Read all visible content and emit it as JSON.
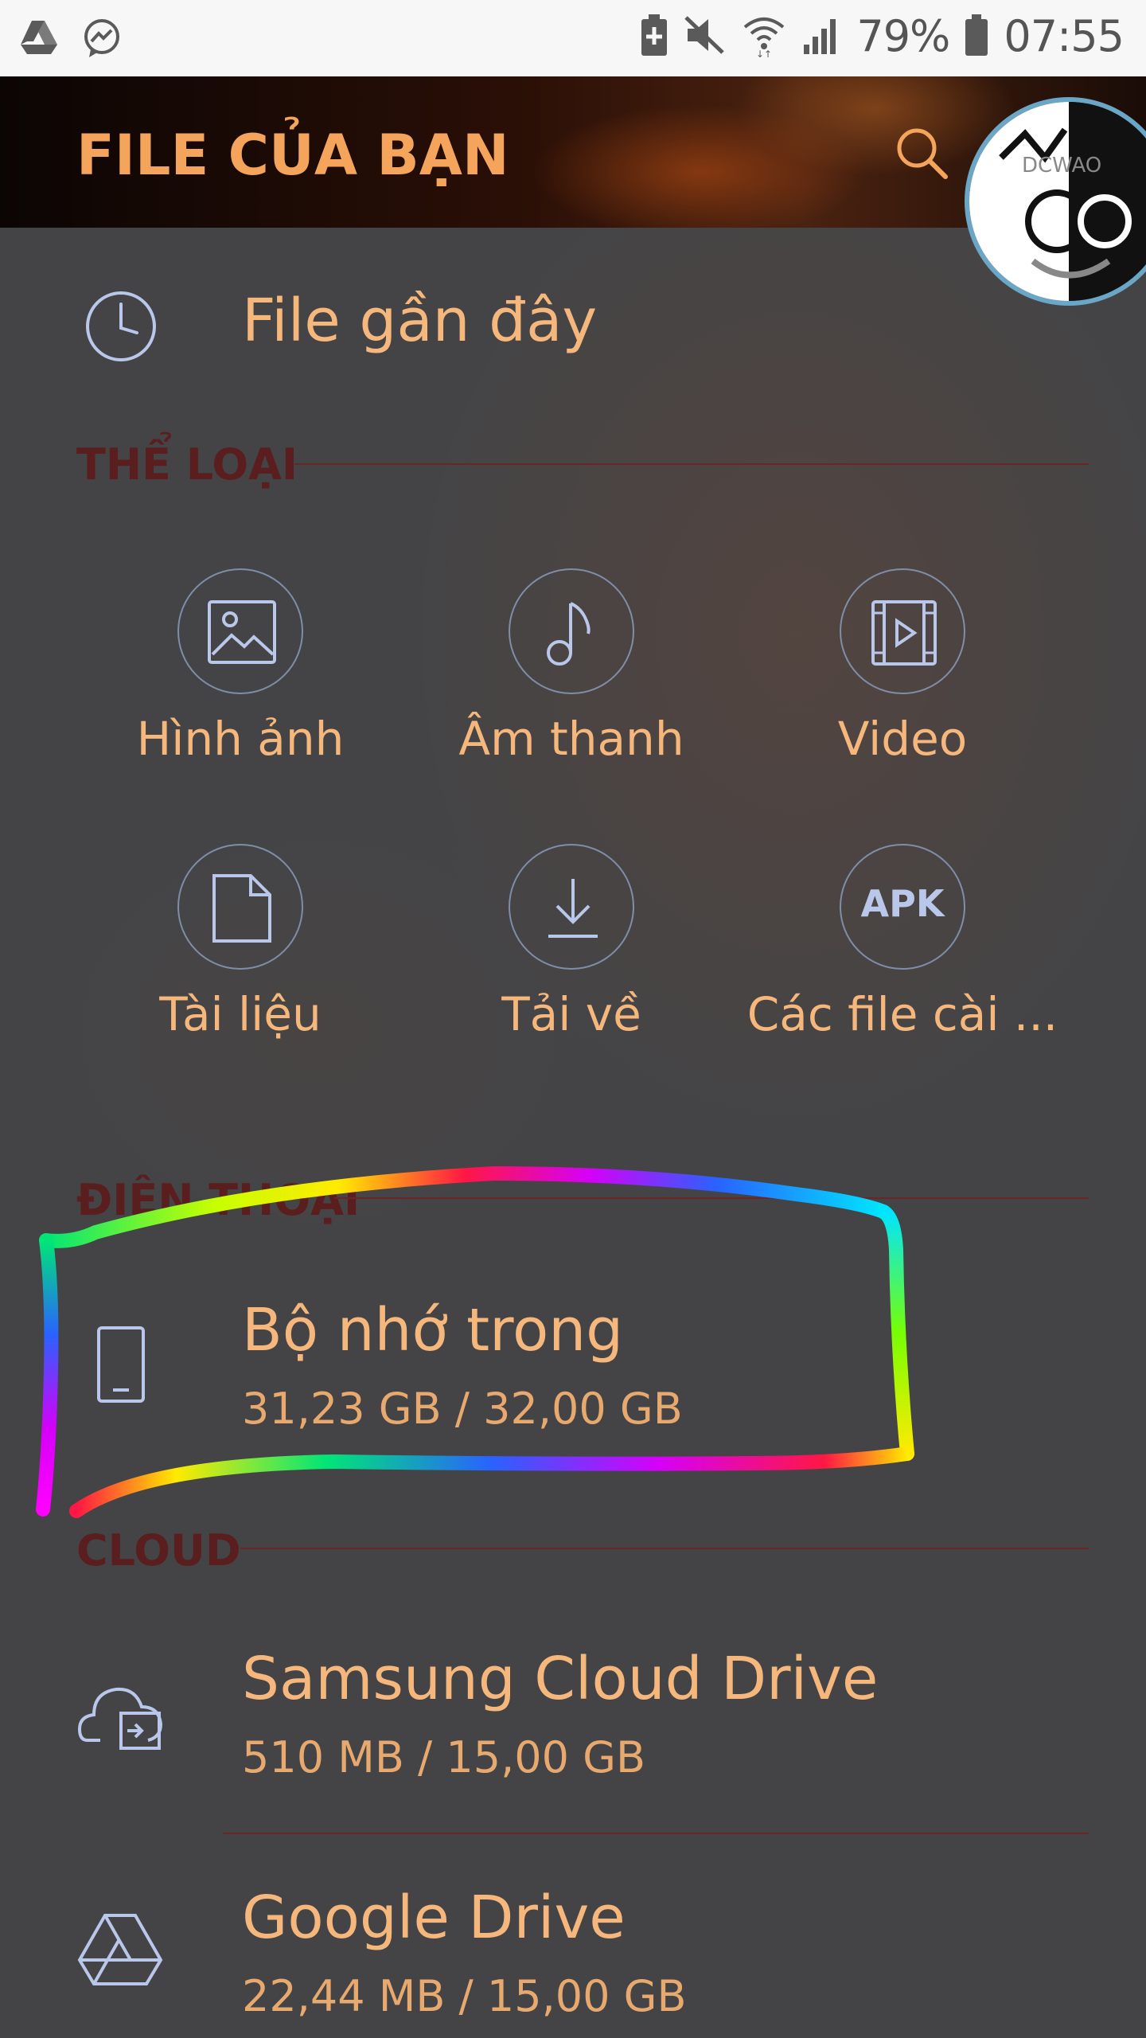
{
  "status_bar": {
    "battery_percent": "79%",
    "time": "07:55",
    "left_icons": [
      "google-drive-icon",
      "messenger-icon"
    ],
    "right_icons": [
      "battery-saver-icon",
      "mute-icon",
      "wifi-icon",
      "signal-icon",
      "battery-icon"
    ]
  },
  "header": {
    "title": "FILE CỦA BẠN",
    "avatar_text": "DCWAO"
  },
  "recent": {
    "label": "File gần đây"
  },
  "categories": {
    "heading": "THỂ LOẠI",
    "items": [
      {
        "label": "Hình ảnh",
        "icon": "image-icon"
      },
      {
        "label": "Âm thanh",
        "icon": "music-note-icon"
      },
      {
        "label": "Video",
        "icon": "video-icon"
      },
      {
        "label": "Tài liệu",
        "icon": "document-icon"
      },
      {
        "label": "Tải về",
        "icon": "download-icon"
      },
      {
        "label": "Các file cài ...",
        "icon": "apk-icon",
        "icon_text": "APK"
      }
    ]
  },
  "phone": {
    "heading": "ĐIỆN THOẠI",
    "internal": {
      "title": "Bộ nhớ trong",
      "usage": "31,23 GB / 32,00 GB"
    }
  },
  "cloud": {
    "heading": "CLOUD",
    "items": [
      {
        "title": "Samsung Cloud Drive",
        "usage": "510 MB / 15,00 GB"
      },
      {
        "title": "Google Drive",
        "usage": "22,44 MB / 15,00 GB"
      }
    ]
  },
  "colors": {
    "accent": "#f6b77c",
    "section_heading": "#5a1e1e",
    "icon_stroke": "#b9c8ea",
    "background": "#444446"
  }
}
